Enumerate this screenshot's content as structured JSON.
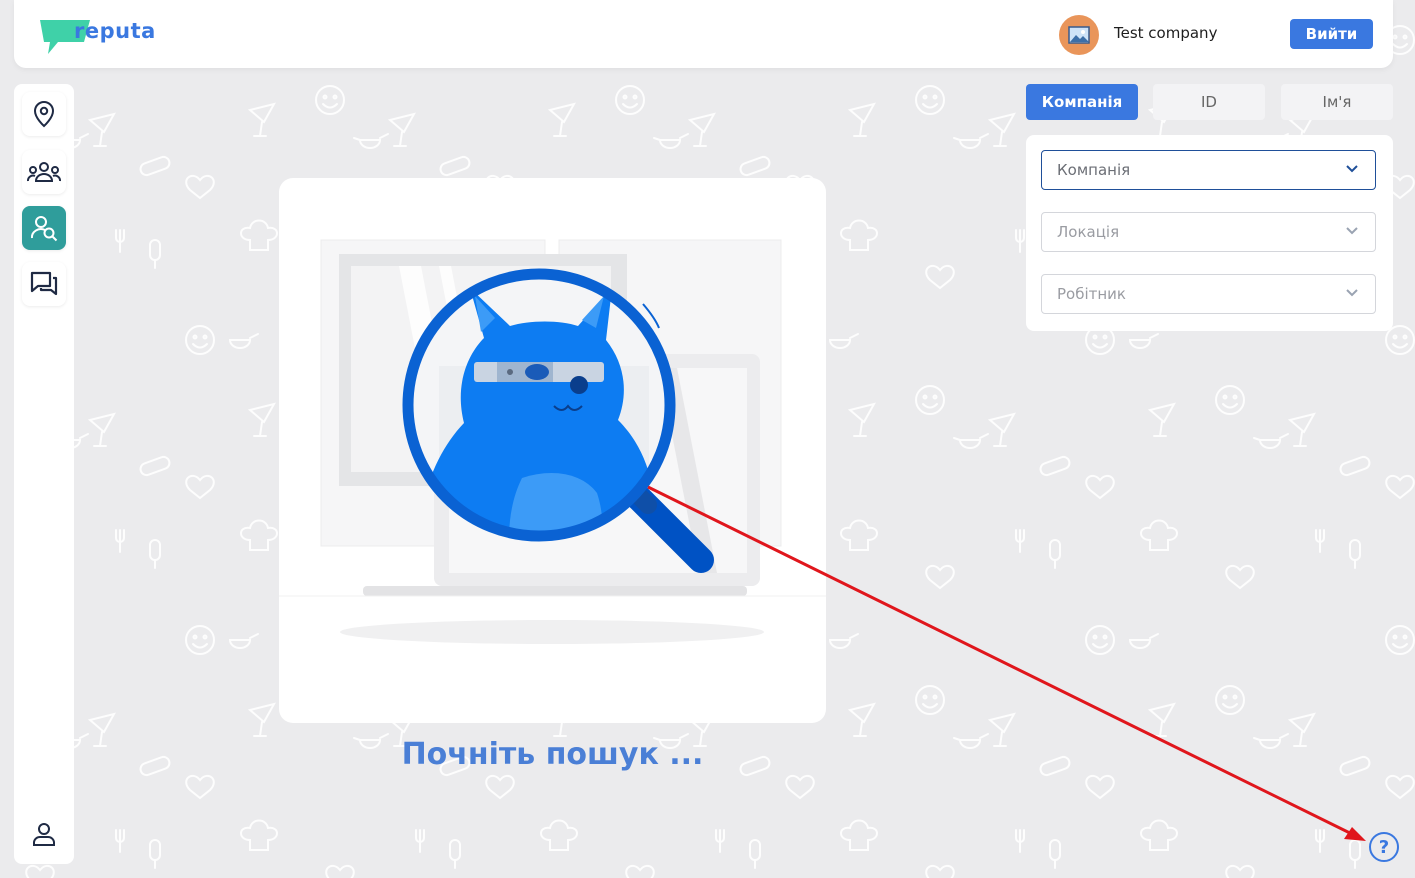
{
  "header": {
    "logo_text": "reputa",
    "company_name": "Test company",
    "logout_label": "Вийти"
  },
  "sidebar": {
    "items": [
      {
        "icon": "location-pin-icon"
      },
      {
        "icon": "team-icon"
      },
      {
        "icon": "user-search-icon",
        "active": true
      },
      {
        "icon": "chat-icon"
      }
    ],
    "bottom_icon": "profile-icon"
  },
  "main": {
    "empty_state_text": "Почніть пошук ..."
  },
  "search": {
    "tabs": [
      {
        "label": "Компанія",
        "active": true
      },
      {
        "label": "ID"
      },
      {
        "label": "Ім'я"
      }
    ],
    "fields": [
      {
        "placeholder": "Компанія"
      },
      {
        "placeholder": "Локація"
      },
      {
        "placeholder": "Робітник"
      }
    ]
  },
  "help": {
    "icon": "help-icon",
    "label": "?"
  },
  "colors": {
    "accent": "#3a78e0",
    "active_sidebar": "#2f9d9b",
    "annotation_arrow": "#e0161c",
    "background": "#ebebed"
  }
}
